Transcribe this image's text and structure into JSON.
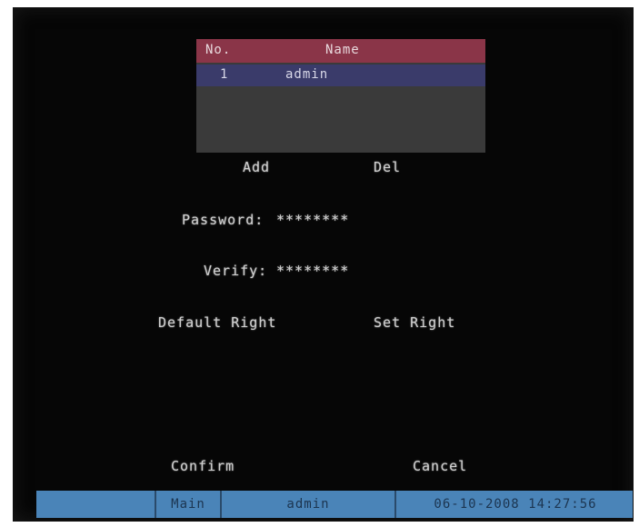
{
  "user_table": {
    "headers": {
      "no": "No.",
      "name": "Name"
    },
    "rows": [
      {
        "no": "1",
        "name": "admin"
      }
    ]
  },
  "actions": {
    "add": "Add",
    "del": "Del"
  },
  "password": {
    "label": "Password:",
    "value": "********"
  },
  "verify": {
    "label": "Verify:",
    "value": "********"
  },
  "rights": {
    "default": "Default Right",
    "set": "Set Right"
  },
  "dialog": {
    "confirm": "Confirm",
    "cancel": "Cancel"
  },
  "status_bar": {
    "menu": "Main",
    "user": "admin",
    "datetime": "06-10-2008 14:27:56"
  }
}
